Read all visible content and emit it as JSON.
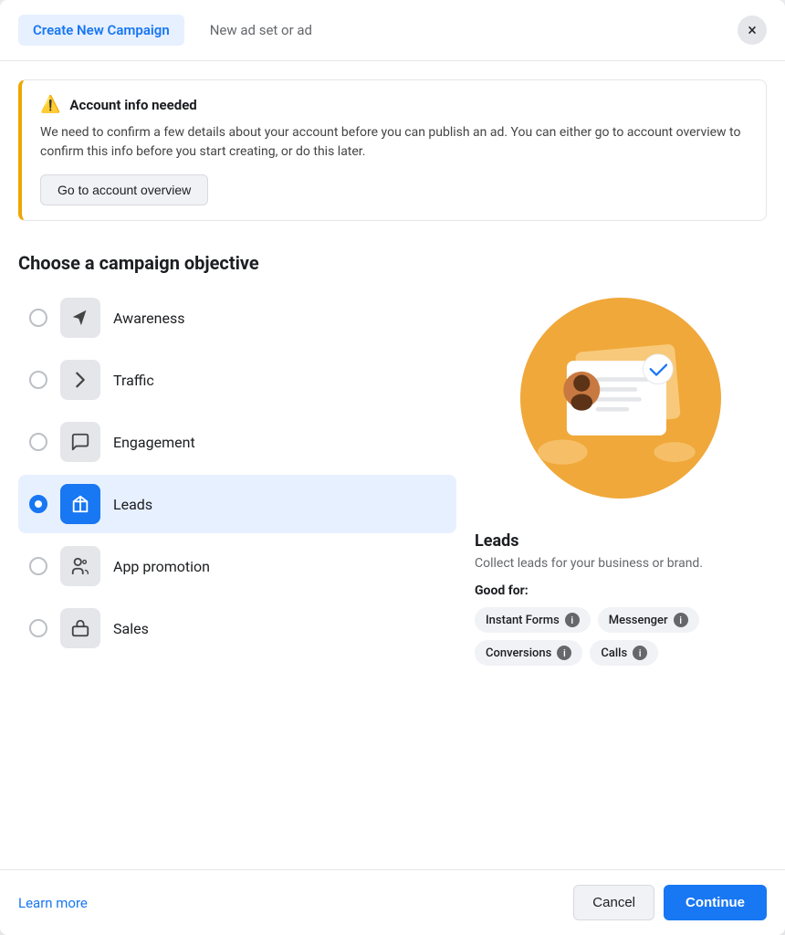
{
  "header": {
    "tab_active": "Create New Campaign",
    "tab_inactive": "New ad set or ad",
    "close_label": "×"
  },
  "alert": {
    "icon": "⚠️",
    "title": "Account info needed",
    "body": "We need to confirm a few details about your account before you can publish an ad. You can either go to account overview to confirm this info before you start creating, or do this later.",
    "button_label": "Go to account overview"
  },
  "section": {
    "title": "Choose a campaign objective"
  },
  "objectives": [
    {
      "id": "awareness",
      "label": "Awareness",
      "icon": "📣",
      "selected": false
    },
    {
      "id": "traffic",
      "label": "Traffic",
      "icon": "▶",
      "selected": false
    },
    {
      "id": "engagement",
      "label": "Engagement",
      "icon": "💬",
      "selected": false
    },
    {
      "id": "leads",
      "label": "Leads",
      "icon": "▼",
      "selected": true
    },
    {
      "id": "app-promotion",
      "label": "App promotion",
      "icon": "👥",
      "selected": false
    },
    {
      "id": "sales",
      "label": "Sales",
      "icon": "🧳",
      "selected": false
    }
  ],
  "detail": {
    "title": "Leads",
    "description": "Collect leads for your business or brand.",
    "good_for_label": "Good for:",
    "tags": [
      {
        "label": "Instant Forms"
      },
      {
        "label": "Messenger"
      },
      {
        "label": "Conversions"
      },
      {
        "label": "Calls"
      }
    ]
  },
  "footer": {
    "learn_more": "Learn more",
    "cancel": "Cancel",
    "continue": "Continue"
  }
}
